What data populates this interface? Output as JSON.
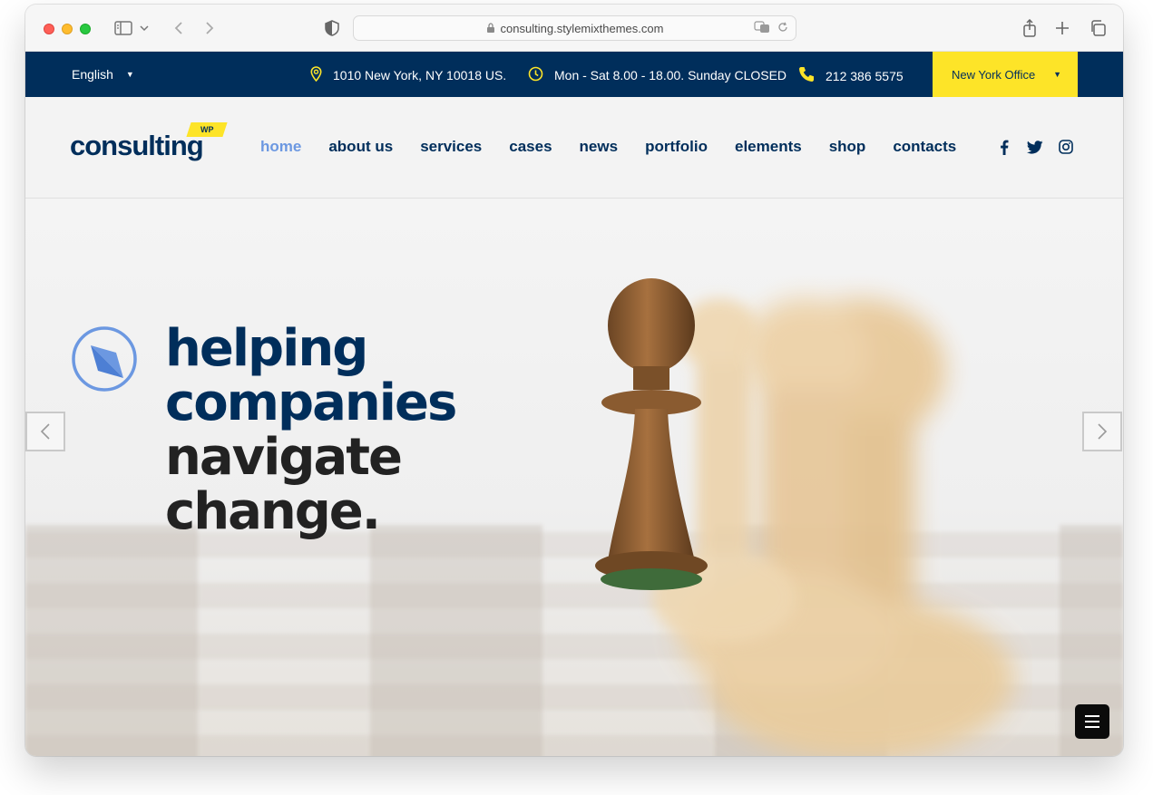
{
  "browser": {
    "url": "consulting.stylemixthemes.com"
  },
  "topbar": {
    "language": "English",
    "address": "1010 New York, NY 10018 US.",
    "hours": "Mon - Sat 8.00 - 18.00. Sunday CLOSED",
    "phone": "212 386 5575",
    "office": "New York Office"
  },
  "logo": {
    "text": "consulting",
    "badge": "WP"
  },
  "nav": {
    "items": [
      {
        "label": "home"
      },
      {
        "label": "about us"
      },
      {
        "label": "services"
      },
      {
        "label": "cases"
      },
      {
        "label": "news"
      },
      {
        "label": "portfolio"
      },
      {
        "label": "elements"
      },
      {
        "label": "shop"
      },
      {
        "label": "contacts"
      }
    ],
    "active": "home"
  },
  "social": [
    "facebook-icon",
    "twitter-icon",
    "instagram-icon"
  ],
  "hero": {
    "line1": "helping",
    "line2": "companies",
    "line3": "navigate",
    "line4": "change."
  },
  "colors": {
    "navy": "#002e5b",
    "yellow": "#fde428",
    "accent_blue": "#6c98e1"
  }
}
